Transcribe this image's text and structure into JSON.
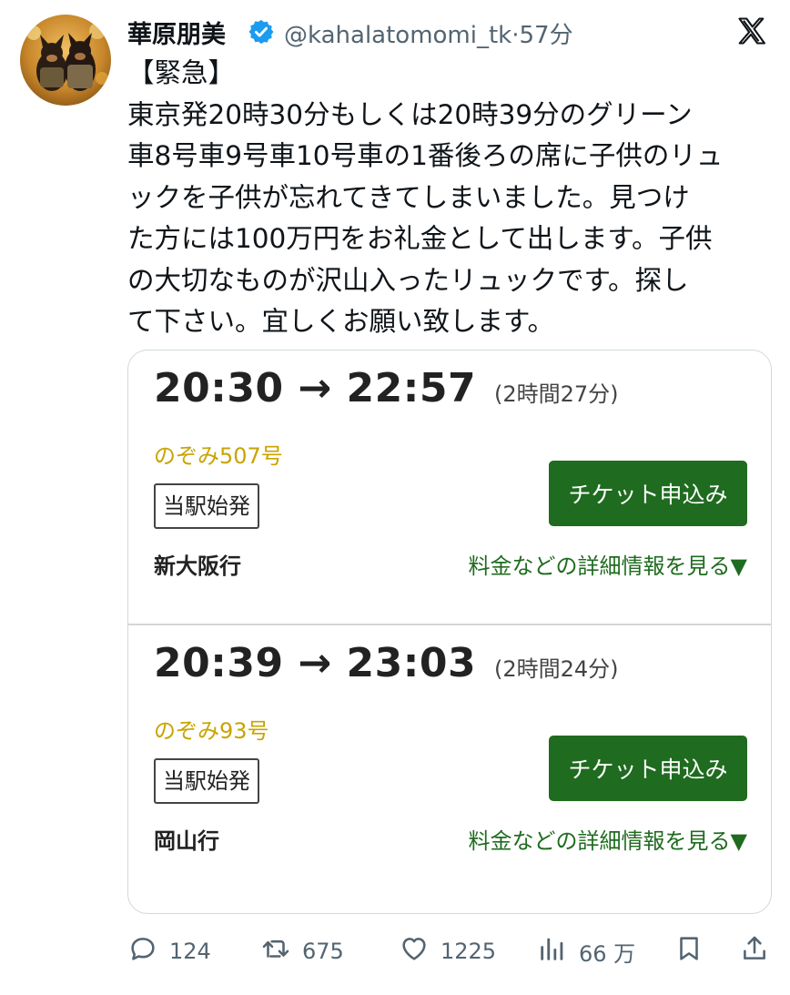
{
  "tweet": {
    "display_name": "華原朋美",
    "handle": "@kahalatomomi_tk",
    "separator": "·",
    "timestamp": "57分",
    "verified": true,
    "text_lines": [
      "【緊急】",
      "東京発20時30分もしくは20時39分のグリーン",
      "車8号車9号車10号車の1番後ろの席に子供のリュ",
      "ックを子供が忘れてきてしまいました。見つけ",
      "た方には100万円をお礼金として出します。子供",
      "の大切なものが沢山入ったリュックです。探し",
      "て下さい。宜しくお願い致します。"
    ]
  },
  "trains": [
    {
      "time": "20:30 → 22:57",
      "duration": "(2時間27分)",
      "name": "のぞみ507号",
      "badge": "当駅始発",
      "button": "チケット申込み",
      "destination": "新大阪行",
      "details": "料金などの詳細情報を見る▼"
    },
    {
      "time": "20:39 → 23:03",
      "duration": "(2時間24分)",
      "name": "のぞみ93号",
      "badge": "当駅始発",
      "button": "チケット申込み",
      "destination": "岡山行",
      "details": "料金などの詳細情報を見る▼"
    }
  ],
  "actions": {
    "replies": "124",
    "retweets": "675",
    "likes": "1225",
    "views": "66 万"
  },
  "icons": {
    "avatar": "avatar-photo-dogs",
    "verified": "verified-badge-icon",
    "logo": "x-logo-icon",
    "reply": "reply-icon",
    "retweet": "retweet-icon",
    "like": "heart-icon",
    "views": "views-icon",
    "bookmark": "bookmark-icon",
    "share": "share-icon"
  },
  "colors": {
    "verified": "#1d9bf0",
    "train_name": "#c8a400",
    "button": "#1f6b1f",
    "link": "#1f6b1f",
    "muted": "#536471"
  }
}
